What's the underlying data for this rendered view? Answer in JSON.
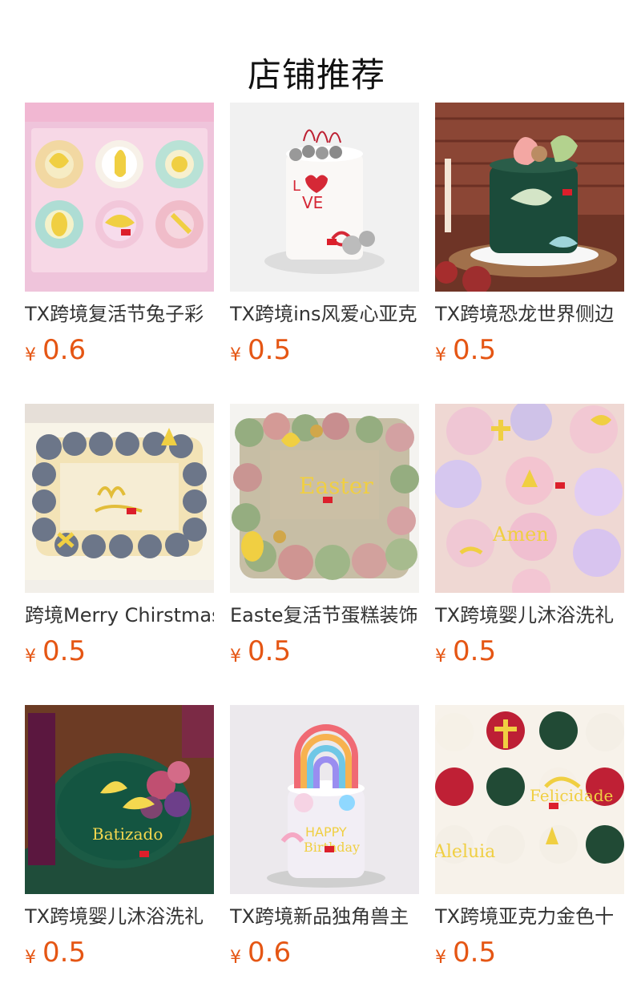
{
  "page": {
    "title": "店铺推荐"
  },
  "products": [
    {
      "name": "TX跨境复活节兔子彩",
      "currency": "¥",
      "price": "0.6",
      "image": "easter-cupcakes-pink-box"
    },
    {
      "name": "TX跨境ins风爱心亚克",
      "currency": "¥",
      "price": "0.5",
      "image": "love-cake-white"
    },
    {
      "name": "TX跨境恐龙世界侧边",
      "currency": "¥",
      "price": "0.5",
      "image": "dinosaur-green-cake"
    },
    {
      "name": "跨境Merry Chirstmas",
      "currency": "¥",
      "price": "0.5",
      "image": "christmas-sheet-cake"
    },
    {
      "name": "Easte复活节蛋糕装饰",
      "currency": "¥",
      "price": "0.5",
      "image": "easter-sheet-cake"
    },
    {
      "name": "TX跨境婴儿沐浴洗礼",
      "currency": "¥",
      "price": "0.5",
      "image": "amen-cupcakes"
    },
    {
      "name": "TX跨境婴儿沐浴洗礼",
      "currency": "¥",
      "price": "0.5",
      "image": "baptism-green-cake"
    },
    {
      "name": "TX跨境新品独角兽主",
      "currency": "¥",
      "price": "0.6",
      "image": "unicorn-rainbow-cake"
    },
    {
      "name": "TX跨境亚克力金色十",
      "currency": "¥",
      "price": "0.5",
      "image": "christmas-cross-cupcakes"
    }
  ],
  "colors": {
    "price": "#e55614",
    "title": "#111111",
    "text": "#333333",
    "background": "#ffffff"
  }
}
